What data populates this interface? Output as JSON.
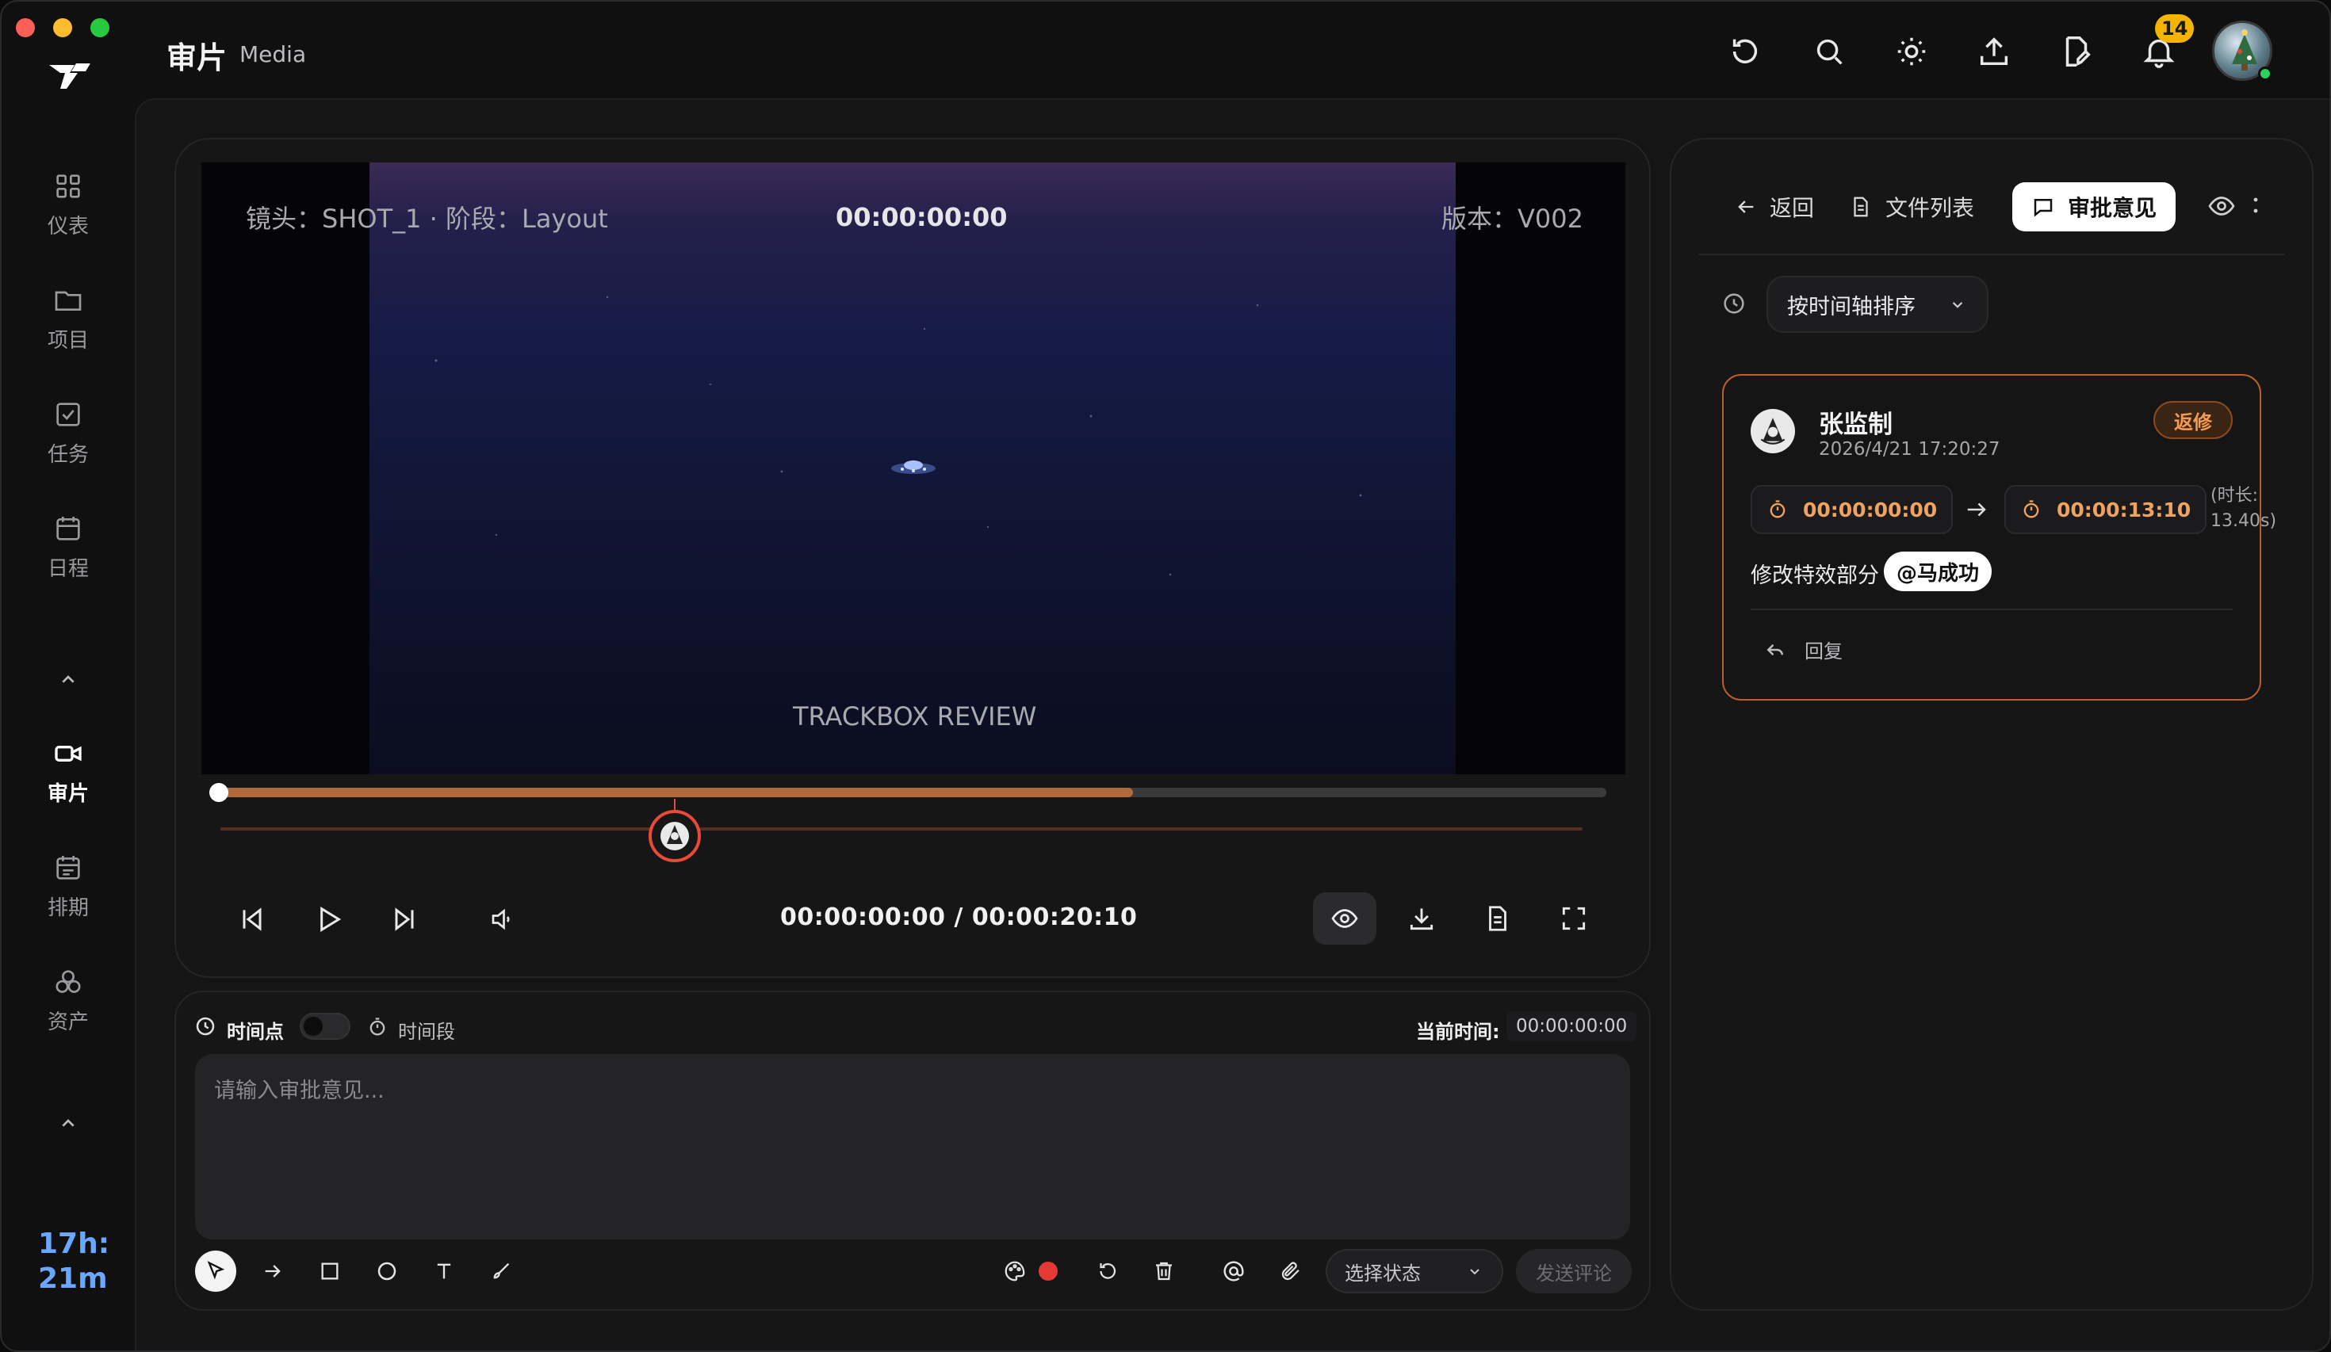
{
  "app": {
    "title": "审片",
    "subtitle": "Media"
  },
  "notifications": {
    "count": "14"
  },
  "sidebar": {
    "items": [
      {
        "label": "仪表"
      },
      {
        "label": "项目"
      },
      {
        "label": "任务"
      },
      {
        "label": "日程"
      },
      {
        "label": "审片"
      },
      {
        "label": "排期"
      },
      {
        "label": "资产"
      }
    ],
    "timer": {
      "line1": "17h:",
      "line2": "21m"
    }
  },
  "player": {
    "shot_info": "镜头：SHOT_1 · 阶段：Layout",
    "overlay_time": "00:00:00:00",
    "version": "版本：V002",
    "watermark": "TRACKBOX REVIEW",
    "timecode": "00:00:00:00 / 00:00:20:10",
    "progress_buffered": 0.66
  },
  "composer": {
    "timepoint_label": "时间点",
    "range_label": "时间段",
    "current_time_label": "当前时间:",
    "current_time_value": "00:00:00:00",
    "placeholder": "请输入审批意见...",
    "status_placeholder": "选择状态",
    "send_label": "发送评论",
    "color_dot": "#e53935"
  },
  "right_panel": {
    "back_label": "返回",
    "files_label": "文件列表",
    "comments_label": "审批意见",
    "sort_label": "按时间轴排序"
  },
  "comment": {
    "author": "张监制",
    "datetime": "2026/4/21 17:20:27",
    "status": "返修",
    "start": "00:00:00:00",
    "end": "00:00:13:10",
    "duration_line1": "(时长:",
    "duration_line2": "13.40s)",
    "text": "修改特效部分",
    "mention": "@马成功",
    "reply_label": "回复"
  },
  "colors": {
    "accent": "#b06a3e",
    "status": "#f59a4e",
    "marker": "#e84a3a"
  }
}
